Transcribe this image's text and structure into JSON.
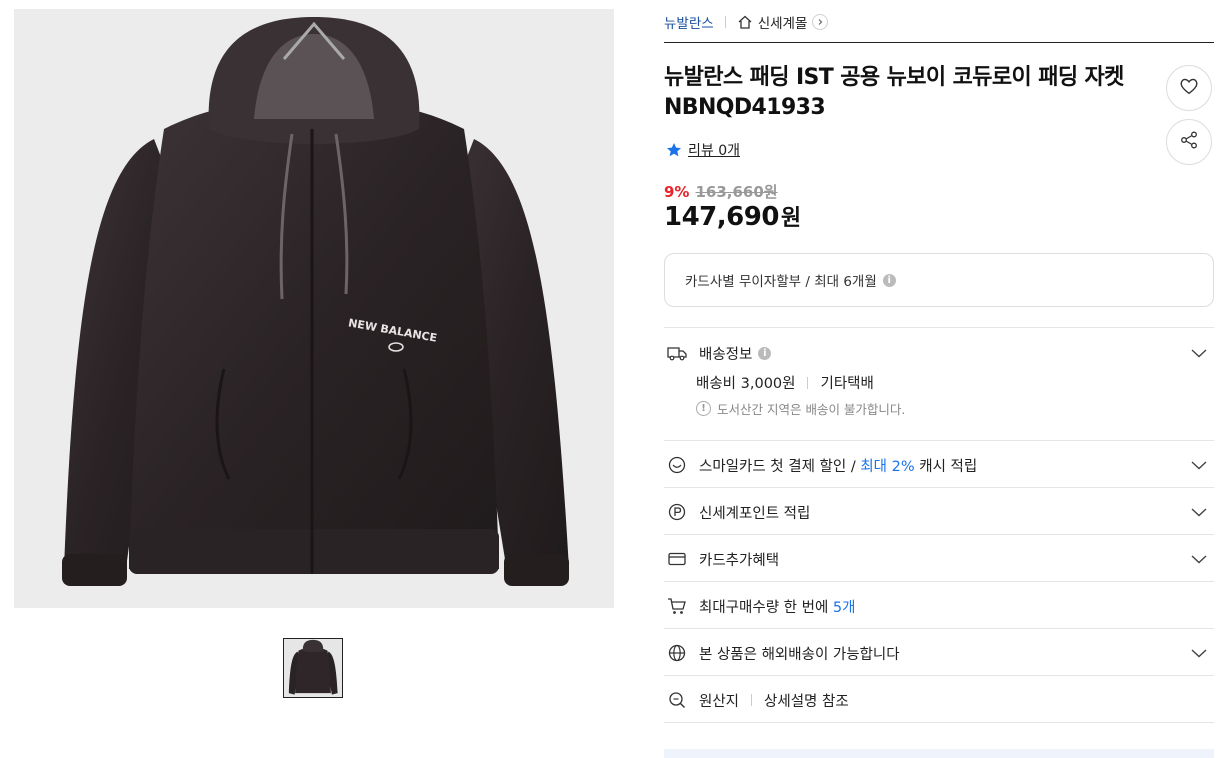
{
  "breadcrumb": {
    "brand": "뉴발란스",
    "store": "신세계몰"
  },
  "product": {
    "title": "뉴발란스 패딩 IST 공용 뉴보이 코듀로이 패딩 자켓 NBNQD41933",
    "review_link": "리뷰 0개",
    "discount_rate": "9%",
    "original_price": "163,660원",
    "price_number": "147,690",
    "price_unit": "원",
    "image_logo_text": "NEW BALANCE"
  },
  "installment": {
    "text": "카드사별 무이자할부 / 최대 6개월",
    "info_glyph": "i"
  },
  "shipping": {
    "title": "배송정보",
    "fee": "배송비 3,000원",
    "carrier": "기타택배",
    "notice": "도서산간 지역은 배송이 불가합니다.",
    "notice_glyph": "!"
  },
  "benefits": {
    "smile_prefix": "스마일카드 첫 결제 할인 / ",
    "smile_highlight": "최대 2%",
    "smile_suffix": " 캐시 적립",
    "points": "신세계포인트 적립",
    "card_extra": "카드추가혜택",
    "max_qty_prefix": "최대구매수량 한 번에 ",
    "max_qty_value": "5개",
    "overseas": "본 상품은 해외배송이 가능합니다",
    "origin_label": "원산지",
    "origin_value": "상세설명 참조"
  },
  "colors": {
    "accent_blue": "#1a73e8",
    "discount_red": "#e8242c",
    "brand_navy": "#1a4fa0"
  }
}
